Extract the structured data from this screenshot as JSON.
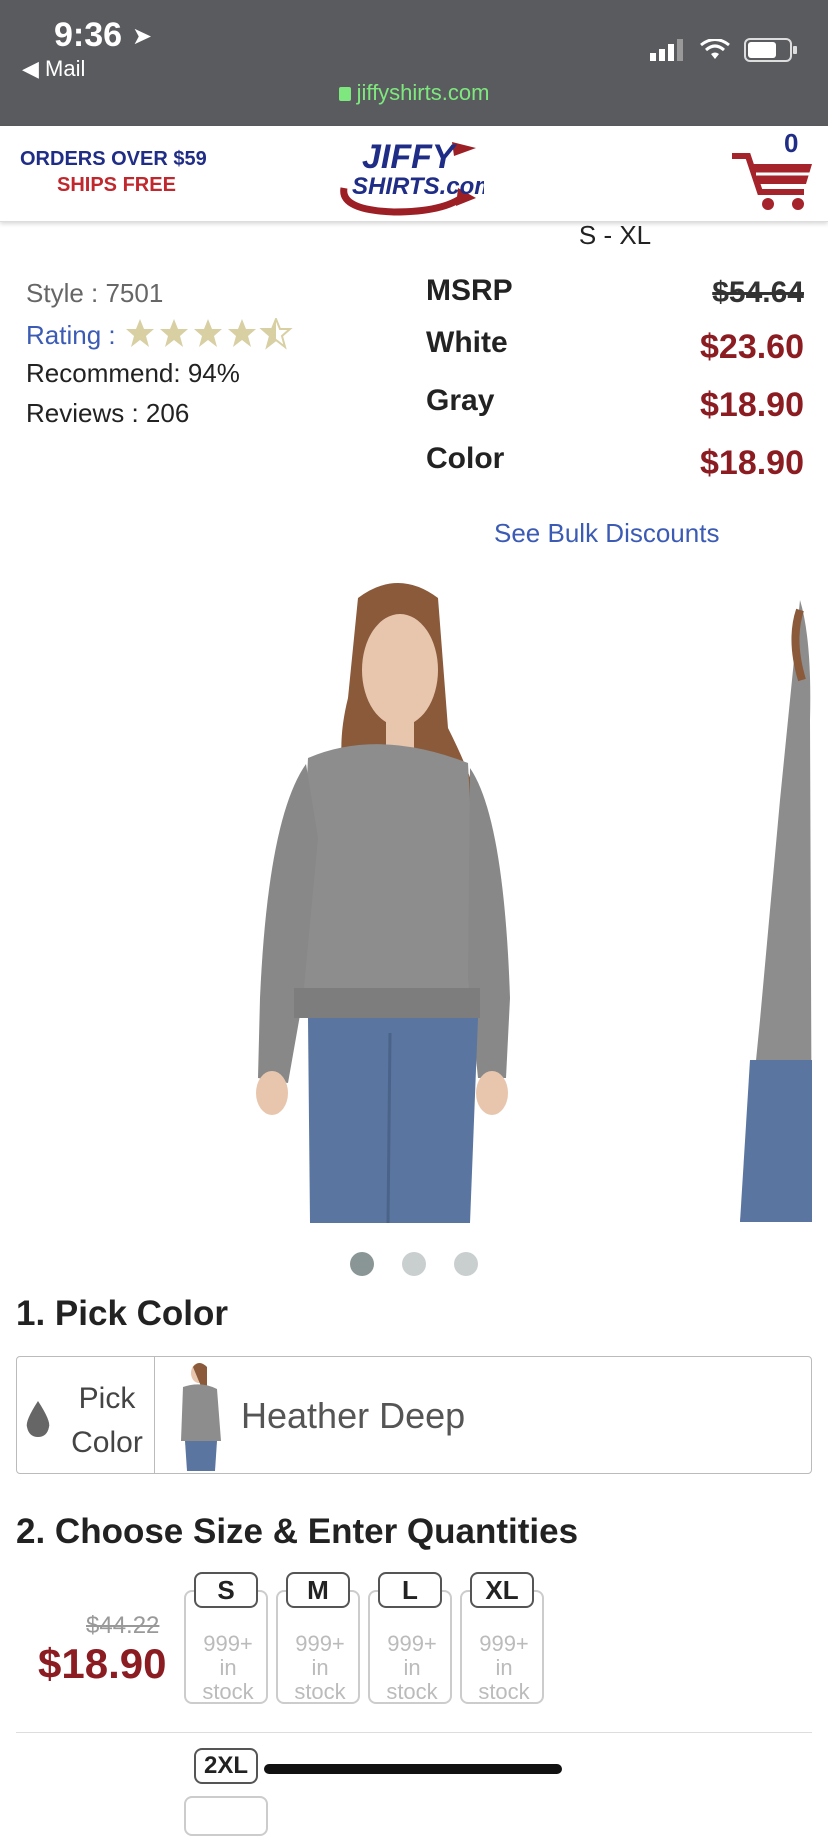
{
  "status_bar": {
    "time": "9:36",
    "back_label": "Mail",
    "url": "jiffyshirts.com"
  },
  "header": {
    "promo_line1": "ORDERS OVER $59",
    "promo_line2": "SHIPS FREE",
    "logo_text_top": "JIFFY",
    "logo_text_bottom": "SHIRTS.com",
    "cart_count": "0"
  },
  "product": {
    "size_range": "S - XL",
    "style": "Style : 7501",
    "rating_label": "Rating :",
    "rating_stars": 4.5,
    "recommend": "Recommend: 94%",
    "reviews": "Reviews : 206"
  },
  "prices": [
    {
      "label": "MSRP",
      "value": "$54.64",
      "strike": true
    },
    {
      "label": "White",
      "value": "$23.60",
      "strike": false
    },
    {
      "label": "Gray",
      "value": "$18.90",
      "strike": false
    },
    {
      "label": "Color",
      "value": "$18.90",
      "strike": false
    }
  ],
  "bulk_link": "See Bulk Discounts",
  "carousel": {
    "count": 3,
    "active_index": 0
  },
  "pick_color": {
    "heading": "1. Pick Color",
    "button_line1": "Pick",
    "button_line2": "Color",
    "selected_color": "Heather Deep"
  },
  "size_qty": {
    "heading": "2. Choose Size & Enter Quantities",
    "old_price": "$44.22",
    "new_price": "$18.90",
    "sizes": [
      {
        "size": "S",
        "stock1": "999+",
        "stock2": "in",
        "stock3": "stock"
      },
      {
        "size": "M",
        "stock1": "999+",
        "stock2": "in",
        "stock3": "stock"
      },
      {
        "size": "L",
        "stock1": "999+",
        "stock2": "in",
        "stock3": "stock"
      },
      {
        "size": "XL",
        "stock1": "999+",
        "stock2": "in",
        "stock3": "stock"
      }
    ],
    "next_size": "2XL"
  },
  "colors": {
    "brand_blue": "#1f2d86",
    "brand_red": "#c0282d",
    "price_red": "#8b1c21",
    "link_blue": "#3b5bb5",
    "star": "#d8cfa3"
  }
}
